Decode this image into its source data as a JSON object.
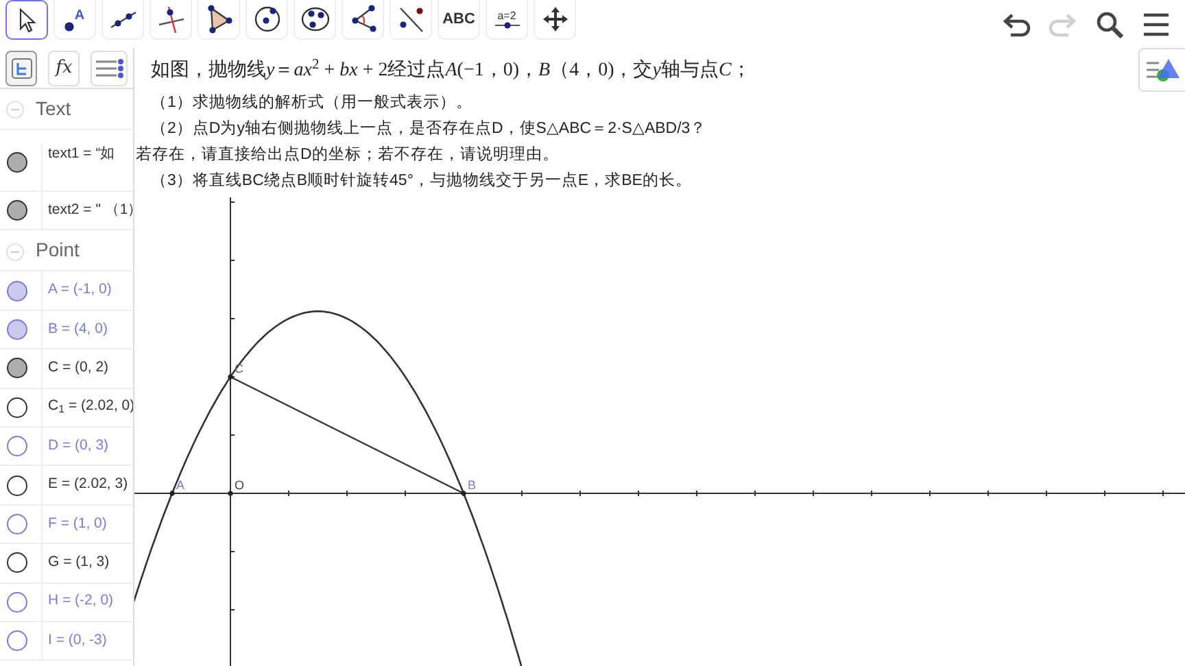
{
  "toolbar": {
    "tools": [
      {
        "kind": "move",
        "selected": true
      },
      {
        "kind": "point",
        "label": "A",
        "selected": false
      },
      {
        "kind": "line",
        "selected": false
      },
      {
        "kind": "perpendicular",
        "selected": false
      },
      {
        "kind": "polygon",
        "selected": false
      },
      {
        "kind": "circle-center",
        "selected": false
      },
      {
        "kind": "circle-three",
        "selected": false
      },
      {
        "kind": "angle",
        "selected": false
      },
      {
        "kind": "reflect",
        "selected": false
      },
      {
        "kind": "text",
        "label": "ABC",
        "selected": false
      },
      {
        "kind": "slider",
        "label": "a=2",
        "selected": false
      },
      {
        "kind": "move-view",
        "selected": false
      }
    ],
    "actions": [
      {
        "kind": "undo",
        "disabled": false
      },
      {
        "kind": "redo",
        "disabled": true
      },
      {
        "kind": "search",
        "disabled": false
      },
      {
        "kind": "menu",
        "disabled": false
      }
    ]
  },
  "side_tabs": [
    {
      "kind": "algebra",
      "selected": true
    },
    {
      "kind": "tools",
      "label": "fx",
      "selected": false
    },
    {
      "kind": "settings",
      "selected": false
    }
  ],
  "algebra": [
    {
      "title": "Text",
      "items": [
        {
          "kind": "multiline",
          "text": "text1 = “如",
          "visible": true,
          "color": "#333333"
        },
        {
          "kind": "single",
          "text": "text2 = \" （1）",
          "visible": true,
          "color": "#333333"
        }
      ]
    },
    {
      "title": "Point",
      "items": [
        {
          "kind": "single",
          "text": "A = (-1, 0)",
          "visible": true,
          "color": "#7b7bd6"
        },
        {
          "kind": "single",
          "text": "B = (4, 0)",
          "visible": true,
          "color": "#7b7bd6"
        },
        {
          "kind": "single",
          "text": "C = (0, 2)",
          "visible": true,
          "color": "#333333"
        },
        {
          "kind": "single",
          "text": "C$_{1}$ = (2.02, 0)",
          "visible": false,
          "color": "#333333"
        },
        {
          "kind": "single",
          "text": "D = (0, 3)",
          "visible": false,
          "color": "#7b7bd6"
        },
        {
          "kind": "single",
          "text": "E = (2.02, 3)",
          "visible": false,
          "color": "#333333"
        },
        {
          "kind": "single",
          "text": "F = (1, 0)",
          "visible": false,
          "color": "#7b7bd6"
        },
        {
          "kind": "single",
          "text": "G = (1, 3)",
          "visible": false,
          "color": "#333333"
        },
        {
          "kind": "single",
          "text": "H = (-2, 0)",
          "visible": false,
          "color": "#7b7bd6"
        },
        {
          "kind": "single",
          "text": "I = (0, -3)",
          "visible": false,
          "color": "#7b7bd6"
        }
      ]
    }
  ],
  "problem": {
    "title": [
      {
        "kind": "text",
        "text": "如图，抛物线"
      },
      {
        "kind": "math",
        "text": "y"
      },
      {
        "kind": "text",
        "text": "＝"
      },
      {
        "kind": "math",
        "text": "ax"
      },
      {
        "kind": "sup",
        "text": "2"
      },
      {
        "kind": "text",
        "text": " + "
      },
      {
        "kind": "math",
        "text": "bx"
      },
      {
        "kind": "text",
        "text": " + 2经过点"
      },
      {
        "kind": "math",
        "text": "A"
      },
      {
        "kind": "text",
        "text": "(−1，0)，"
      },
      {
        "kind": "math",
        "text": "B"
      },
      {
        "kind": "text",
        "text": "（4，0)，交"
      },
      {
        "kind": "math",
        "text": "y"
      },
      {
        "kind": "text",
        "text": "轴与点"
      },
      {
        "kind": "math",
        "text": "C"
      },
      {
        "kind": "text",
        "text": "；"
      }
    ],
    "lines": [
      {
        "kind": "indented",
        "text": "（1）求抛物线的解析式（用一般式表示）。"
      },
      {
        "kind": "indented",
        "text": "（2）点D为y轴右侧抛物线上一点，是否存在点D，使S△ABC＝2·S△ABD/3？"
      },
      {
        "kind": "plain",
        "text": "若存在，请直接给出点D的坐标；若不存在，请说明理由。"
      },
      {
        "kind": "indented",
        "text": "（3）将直线BC绕点B顺时针旋转45°，与抛物线交于另一点E，求BE的长。"
      }
    ]
  },
  "graph": {
    "points": [
      {
        "label": "C",
        "color": "#666666"
      },
      {
        "label": "A",
        "color": "#7b7bd6"
      },
      {
        "label": "O",
        "color": "#444444"
      },
      {
        "label": "B",
        "color": "#7b7bd6"
      }
    ]
  }
}
